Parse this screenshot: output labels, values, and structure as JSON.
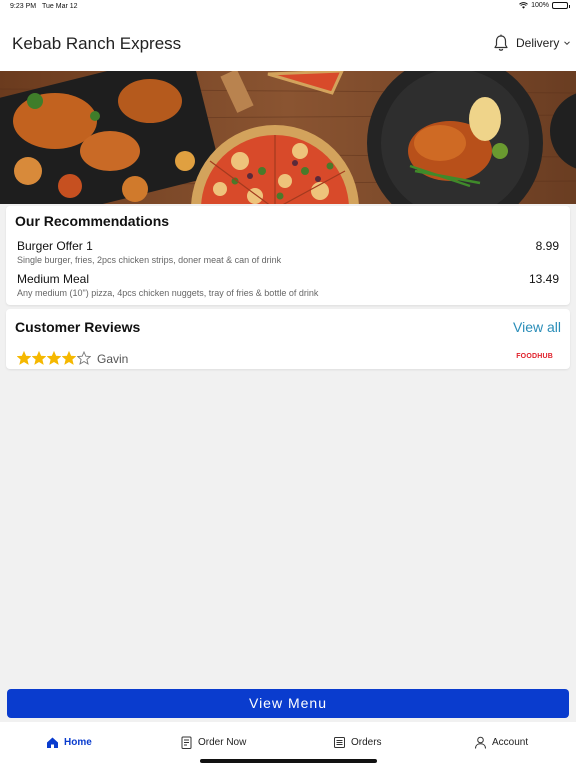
{
  "status_bar": {
    "time": "9:23 PM",
    "date": "Tue Mar 12",
    "battery": "100%"
  },
  "header": {
    "title": "Kebab Ranch Express",
    "mode": "Delivery",
    "notification_icon": "bell-icon",
    "dropdown_icon": "chevron-down-icon"
  },
  "recommendations": {
    "title": "Our Recommendations",
    "items": [
      {
        "name": "Burger Offer 1",
        "description": "Single burger, fries, 2pcs chicken strips, doner meat & can of drink",
        "price": "8.99"
      },
      {
        "name": "Medium Meal",
        "description": "Any medium (10\") pizza, 4pcs chicken nuggets, tray of fries & bottle of drink",
        "price": "13.49"
      }
    ]
  },
  "reviews": {
    "title": "Customer Reviews",
    "view_all": "View all",
    "items": [
      {
        "rating": 4,
        "max_rating": 5,
        "reviewer": "Gavin",
        "source": "FOODHUB"
      }
    ]
  },
  "cta": {
    "label": "View Menu"
  },
  "tabs": [
    {
      "label": "Home",
      "icon": "home-icon",
      "active": true
    },
    {
      "label": "Order Now",
      "icon": "order-icon",
      "active": false
    },
    {
      "label": "Orders",
      "icon": "orders-list-icon",
      "active": false
    },
    {
      "label": "Account",
      "icon": "user-icon",
      "active": false
    }
  ],
  "colors": {
    "primary": "#0a3cce",
    "link": "#2a8db8",
    "star": "#f5b800",
    "brand": "#e0202a"
  }
}
